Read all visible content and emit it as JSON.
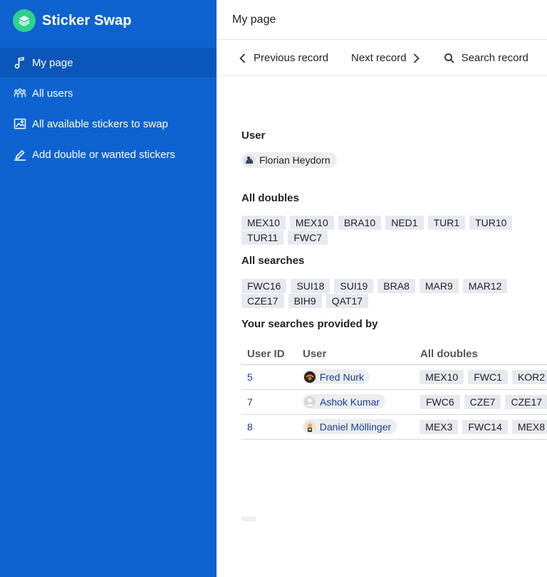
{
  "app": {
    "name": "Sticker Swap",
    "accent": "#0e63d1",
    "logo_color": "#2fd28a"
  },
  "sidebar": {
    "items": [
      {
        "label": "My page",
        "icon": "music-note-icon",
        "active": true
      },
      {
        "label": "All users",
        "icon": "users-group-icon",
        "active": false
      },
      {
        "label": "All available stickers to swap",
        "icon": "image-icon",
        "active": false
      },
      {
        "label": "Add double or wanted stickers",
        "icon": "pencil-icon",
        "active": false
      }
    ]
  },
  "header": {
    "title": "My page"
  },
  "toolbar": {
    "previous_label": "Previous record",
    "next_label": "Next record",
    "search_label": "Search record"
  },
  "record": {
    "user_heading": "User",
    "user_name": "Florian Heydorn",
    "doubles_heading": "All doubles",
    "doubles": [
      "MEX10",
      "MEX10",
      "BRA10",
      "NED1",
      "TUR1",
      "TUR10",
      "TUR11",
      "FWC7"
    ],
    "searches_heading": "All searches",
    "searches": [
      "FWC16",
      "SUI18",
      "SUI19",
      "BRA8",
      "MAR9",
      "MAR12",
      "CZE17",
      "BIH9",
      "QAT17"
    ],
    "provided_heading": "Your searches provided by"
  },
  "table": {
    "columns": {
      "id": "User ID",
      "user": "User",
      "doubles": "All doubles"
    },
    "rows": [
      {
        "id": "5",
        "user": "Fred Nurk",
        "avatar": "avatar-fred-icon",
        "doubles": [
          "MEX10",
          "FWC1",
          "KOR2"
        ]
      },
      {
        "id": "7",
        "user": "Ashok Kumar",
        "avatar": "avatar-placeholder-icon",
        "doubles": [
          "FWC6",
          "CZE7",
          "CZE17"
        ]
      },
      {
        "id": "8",
        "user": "Daniel Möllinger",
        "avatar": "avatar-daniel-icon",
        "doubles": [
          "MEX3",
          "FWC14",
          "MEX8"
        ]
      }
    ]
  }
}
